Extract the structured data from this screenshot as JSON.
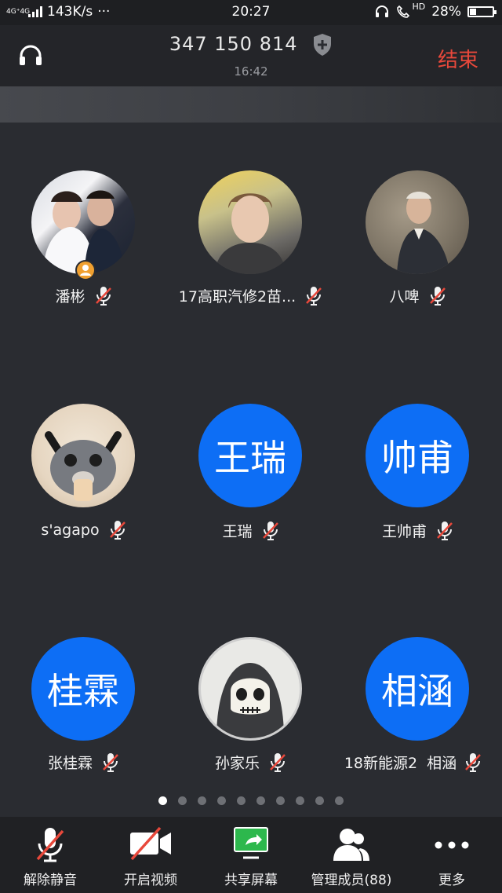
{
  "status": {
    "network": "4G⁺4G",
    "speed": "143K/s",
    "dots": "···",
    "time": "20:27",
    "hd": "HD",
    "battery": "28%",
    "battery_level": 0.28
  },
  "header": {
    "meeting_id": "347 150 814",
    "duration": "16:42",
    "end_label": "结束"
  },
  "participants": [
    {
      "name": "潘彬",
      "avatar_type": "photo",
      "avatar_desc": "wedding-photo",
      "host_badge": true,
      "muted": true
    },
    {
      "name": "17高职汽修2苗...",
      "avatar_type": "photo",
      "avatar_desc": "young-man-photo",
      "muted": true
    },
    {
      "name": "八啤",
      "avatar_type": "photo",
      "avatar_desc": "portrait-painting",
      "muted": true
    },
    {
      "name": "s'agapo",
      "avatar_type": "photo",
      "avatar_desc": "cat-photo",
      "muted": true
    },
    {
      "name": "王瑞",
      "avatar_type": "text",
      "avatar_text": "王瑞",
      "muted": true
    },
    {
      "name": "王帅甫",
      "avatar_type": "text",
      "avatar_text": "帅甫",
      "muted": true
    },
    {
      "name": "张桂霖",
      "avatar_type": "text",
      "avatar_text": "桂霖",
      "muted": true
    },
    {
      "name": "孙家乐",
      "avatar_type": "photo",
      "avatar_desc": "cartoon-hooded-skull",
      "muted": true
    },
    {
      "name": "18新能源2  相涵",
      "avatar_type": "text",
      "avatar_text": "相涵",
      "muted": true
    }
  ],
  "pagination": {
    "total": 10,
    "active": 0
  },
  "toolbar": [
    {
      "label": "解除静音",
      "icon": "mic-muted-icon"
    },
    {
      "label": "开启视频",
      "icon": "video-off-icon"
    },
    {
      "label": "共享屏幕",
      "icon": "share-screen-icon"
    },
    {
      "label": "管理成员(88)",
      "icon": "members-icon"
    },
    {
      "label": "更多",
      "icon": "more-icon"
    }
  ],
  "colors": {
    "accent_blue": "#0d6ef5",
    "end_red": "#e8483b",
    "share_green": "#2db84d"
  }
}
